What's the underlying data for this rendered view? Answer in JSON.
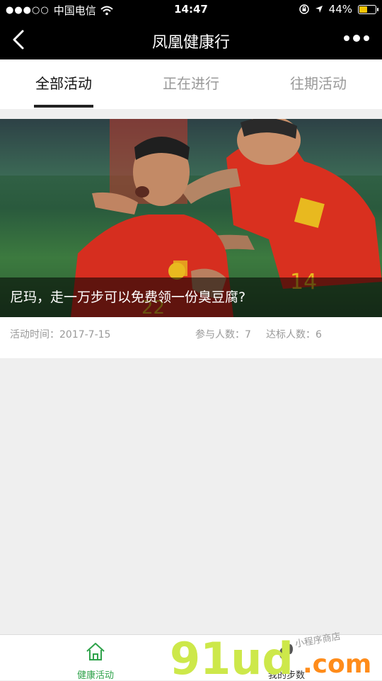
{
  "status_bar": {
    "signal_dots": "●●●○○",
    "carrier": "中国电信",
    "time": "14:47",
    "battery": "44%"
  },
  "navbar": {
    "title": "凤凰健康行"
  },
  "tabs": [
    {
      "label": "全部活动",
      "active": true
    },
    {
      "label": "正在进行",
      "active": false
    },
    {
      "label": "往期活动",
      "active": false
    }
  ],
  "activity": {
    "caption": "尼玛，走一万步可以免费领一份臭豆腐?",
    "time": "活动时间：2017-7-15",
    "participants": "参与人数：7",
    "reached": "达标人数：6"
  },
  "bottom_nav": [
    {
      "label": "健康活动",
      "active": true
    },
    {
      "label": "我的步数",
      "active": false
    }
  ],
  "watermark": {
    "text": "91ud",
    "suffix": ".com",
    "tagline": "小程序商店"
  },
  "colors": {
    "accent": "#2ea24a",
    "battery": "#f5c400"
  }
}
